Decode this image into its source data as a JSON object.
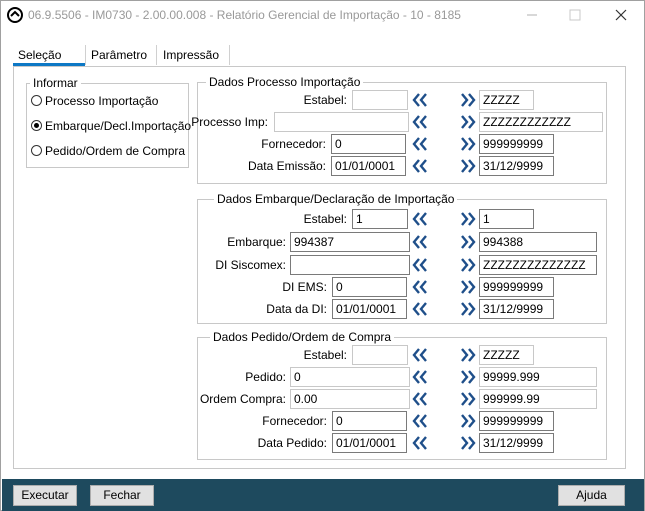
{
  "window": {
    "title": "06.9.5506 - IM0730 - 2.00.00.008 - Relatório Gerencial de Importação - 10 - 8185"
  },
  "tabs": [
    {
      "label": "Seleção",
      "active": true
    },
    {
      "label": "Parâmetro",
      "active": false
    },
    {
      "label": "Impressão",
      "active": false
    }
  ],
  "informar": {
    "legend": "Informar",
    "options": [
      {
        "label": "Processo Importação",
        "selected": false
      },
      {
        "label": "Embarque/Decl.Importação",
        "selected": true
      },
      {
        "label": "Pedido/Ordem de Compra",
        "selected": false
      }
    ]
  },
  "processo": {
    "legend": "Dados Processo Importação",
    "rows": [
      {
        "label": "Estabel:",
        "from": "",
        "to": "ZZZZZ"
      },
      {
        "label": "Processo Imp:",
        "from": "",
        "to": "ZZZZZZZZZZZZ"
      },
      {
        "label": "Fornecedor:",
        "from": "0",
        "to": "999999999"
      },
      {
        "label": "Data Emissão:",
        "from": "01/01/0001",
        "to": "31/12/9999"
      }
    ]
  },
  "embarque": {
    "legend": "Dados Embarque/Declaração de Importação",
    "rows": [
      {
        "label": "Estabel:",
        "from": "1",
        "to": "1"
      },
      {
        "label": "Embarque:",
        "from": "994387",
        "to": "994388"
      },
      {
        "label": "DI Siscomex:",
        "from": "",
        "to": "ZZZZZZZZZZZZZZ"
      },
      {
        "label": "DI EMS:",
        "from": "0",
        "to": "999999999"
      },
      {
        "label": "Data da DI:",
        "from": "01/01/0001",
        "to": "31/12/9999"
      }
    ]
  },
  "pedido": {
    "legend": "Dados Pedido/Ordem de Compra",
    "rows": [
      {
        "label": "Estabel:",
        "from": "",
        "to": "ZZZZZ"
      },
      {
        "label": "Pedido:",
        "from": "0",
        "to": "99999.999"
      },
      {
        "label": "Ordem Compra:",
        "from": "0.00",
        "to": "999999.99"
      },
      {
        "label": "Fornecedor:",
        "from": "0",
        "to": "999999999"
      },
      {
        "label": "Data Pedido:",
        "from": "01/01/0001",
        "to": "31/12/9999"
      }
    ]
  },
  "buttons": {
    "executar": "Executar",
    "fechar": "Fechar",
    "ajuda": "Ajuda"
  },
  "colors": {
    "accent": "#0d78c5",
    "footer": "#1e4a5e",
    "arrow": "#1f4f8a"
  }
}
